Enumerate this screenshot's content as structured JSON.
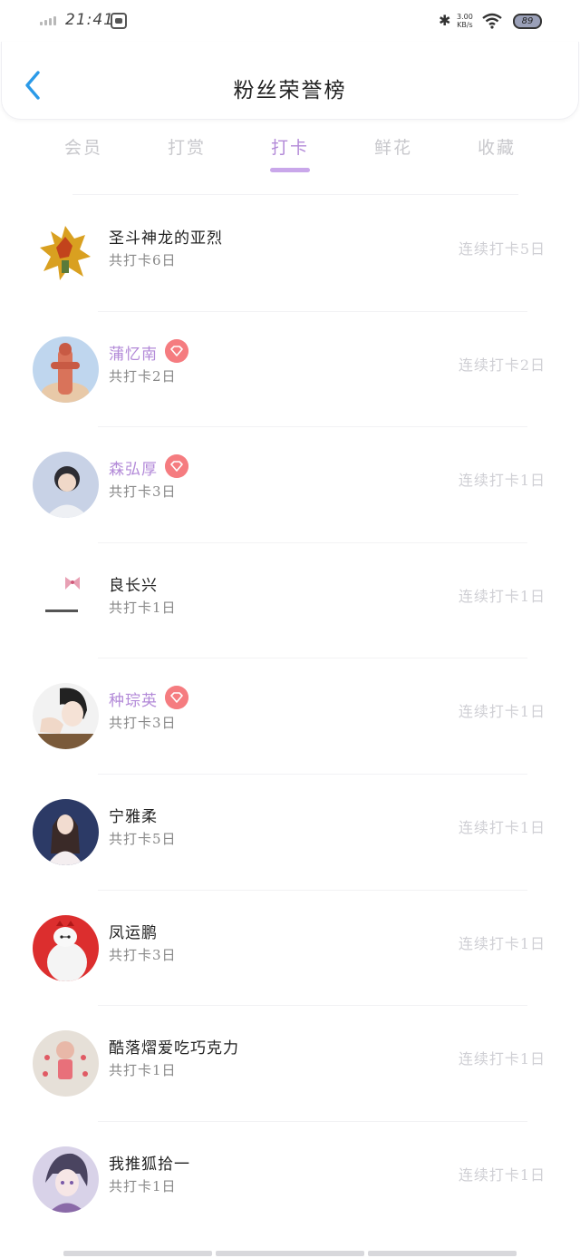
{
  "status_bar": {
    "time": "21:41",
    "net_speed_value": "3.00",
    "net_speed_unit": "KB/s",
    "battery": "89"
  },
  "header": {
    "title": "粉丝荣誉榜"
  },
  "tabs": [
    {
      "label": "会员"
    },
    {
      "label": "打赏"
    },
    {
      "label": "打卡",
      "active": true
    },
    {
      "label": "鲜花"
    },
    {
      "label": "收藏"
    }
  ],
  "colors": {
    "accent": "#b38ad8",
    "tab_underline": "#c9a7ea",
    "diamond_badge": "#f57c80",
    "inactive_text": "#c8c8cc"
  },
  "entries": [
    {
      "name": "圣斗神龙的亚烈",
      "total": "共打卡6日",
      "streak": "连续打卡5日",
      "vip": false,
      "avatar_icon": "robot-figure-avatar"
    },
    {
      "name": "蒲忆南",
      "total": "共打卡2日",
      "streak": "连续打卡2日",
      "vip": true,
      "avatar_icon": "totem-figure-avatar"
    },
    {
      "name": "森弘厚",
      "total": "共打卡3日",
      "streak": "连续打卡1日",
      "vip": true,
      "avatar_icon": "person-photo-avatar"
    },
    {
      "name": "良长兴",
      "total": "共打卡1日",
      "streak": "连续打卡1日",
      "vip": false,
      "avatar_icon": "bow-sketch-avatar"
    },
    {
      "name": "种琮英",
      "total": "共打卡3日",
      "streak": "连续打卡1日",
      "vip": true,
      "avatar_icon": "person-photo-avatar"
    },
    {
      "name": "宁雅柔",
      "total": "共打卡5日",
      "streak": "连续打卡1日",
      "vip": false,
      "avatar_icon": "person-photo-avatar"
    },
    {
      "name": "凤运鹏",
      "total": "共打卡3日",
      "streak": "连续打卡1日",
      "vip": false,
      "avatar_icon": "white-robot-avatar"
    },
    {
      "name": "酷落熠爱吃巧克力",
      "total": "共打卡1日",
      "streak": "连续打卡1日",
      "vip": false,
      "avatar_icon": "illustration-avatar"
    },
    {
      "name": "我推狐拾一",
      "total": "共打卡1日",
      "streak": "连续打卡1日",
      "vip": false,
      "avatar_icon": "anime-avatar"
    }
  ]
}
